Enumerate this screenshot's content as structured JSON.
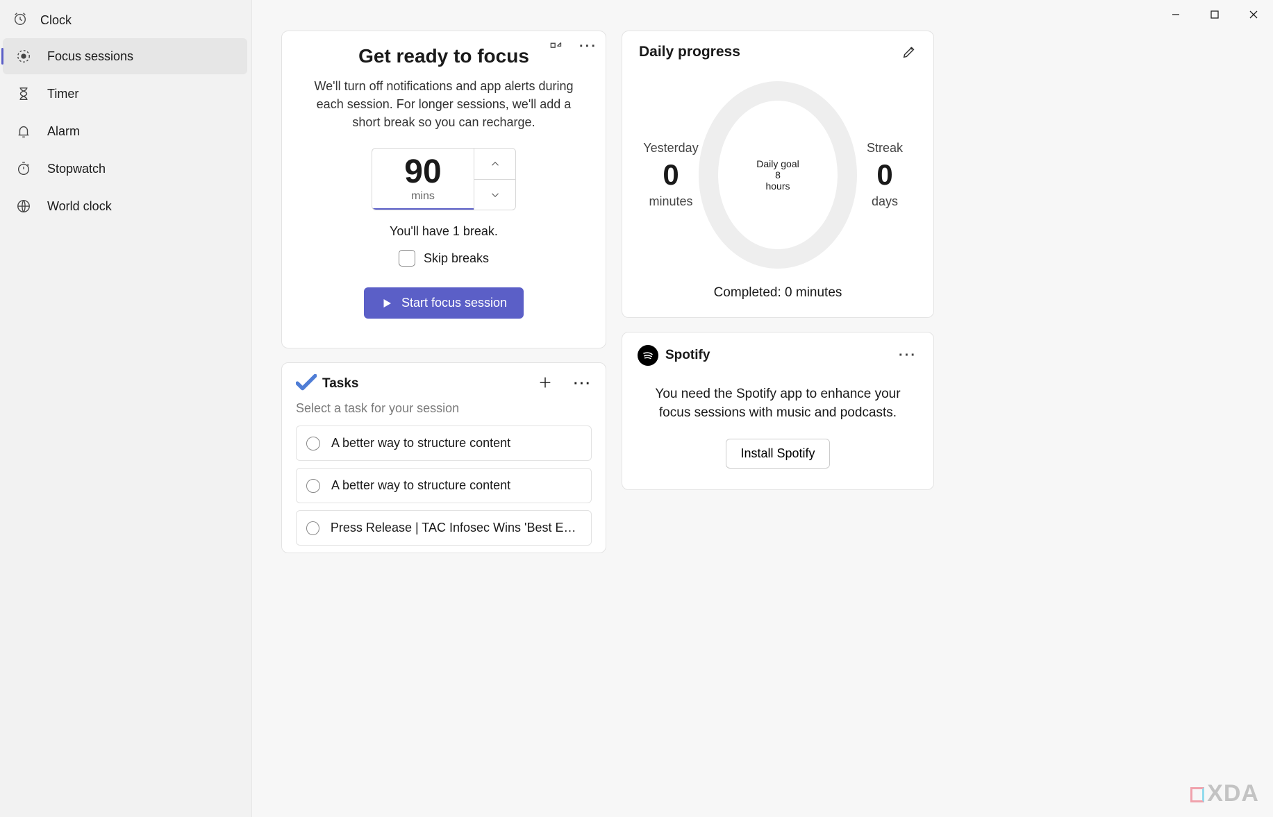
{
  "app": {
    "title": "Clock"
  },
  "nav": {
    "items": [
      {
        "label": "Focus sessions",
        "active": true
      },
      {
        "label": "Timer"
      },
      {
        "label": "Alarm"
      },
      {
        "label": "Stopwatch"
      },
      {
        "label": "World clock"
      }
    ]
  },
  "focus": {
    "title": "Get ready to focus",
    "subtitle": "We'll turn off notifications and app alerts during each session. For longer sessions, we'll add a short break so you can recharge.",
    "minutes": "90",
    "mins_label": "mins",
    "break_note": "You'll have 1 break.",
    "skip_label": "Skip breaks",
    "start_label": "Start focus session"
  },
  "tasks": {
    "title": "Tasks",
    "subtitle": "Select a task for your session",
    "items": [
      {
        "text": "A better way to structure content"
      },
      {
        "text": "A better way to structure content"
      },
      {
        "text": "Press Release | TAC Infosec Wins 'Best Enter…"
      }
    ]
  },
  "progress": {
    "title": "Daily progress",
    "yesterday": {
      "label": "Yesterday",
      "value": "0",
      "unit": "minutes"
    },
    "goal": {
      "label": "Daily goal",
      "value": "8",
      "unit": "hours"
    },
    "streak": {
      "label": "Streak",
      "value": "0",
      "unit": "days"
    },
    "completed": "Completed: 0 minutes"
  },
  "spotify": {
    "name": "Spotify",
    "message": "You need the Spotify app to enhance your focus sessions with music and podcasts.",
    "install": "Install Spotify"
  },
  "watermark": "XDA"
}
